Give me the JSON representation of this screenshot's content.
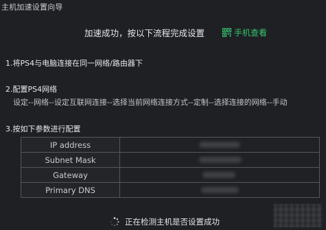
{
  "window": {
    "title": "主机加速设置向导"
  },
  "banner": {
    "success_text": "加速成功，按以下流程完成设置",
    "phone_link_label": "手机查看",
    "accent_color": "#38c46f",
    "phone_link_icon": "qr-code-icon"
  },
  "steps": [
    {
      "title": "1.将PS4与电脑连接在同一网络/路由器下"
    },
    {
      "title": "2.配置PS4网络",
      "description": "设定--网络--设定互联网连接--选择当前网络连接方式--定制--选择连接的网络--手动"
    },
    {
      "title": "3.按如下参数进行配置"
    }
  ],
  "params": {
    "rows": [
      {
        "key": "IP address"
      },
      {
        "key": "Subnet Mask"
      },
      {
        "key": "Gateway"
      },
      {
        "key": "Primary  DNS"
      }
    ]
  },
  "status": {
    "text": "正在检测主机是否设置成功",
    "icon": "loading-spinner-icon"
  }
}
